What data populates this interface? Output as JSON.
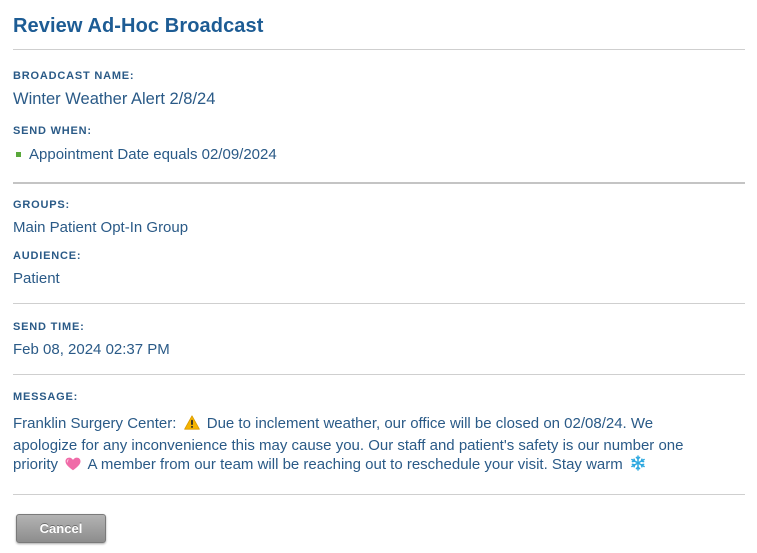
{
  "header": {
    "title": "Review Ad-Hoc Broadcast"
  },
  "broadcast_name": {
    "label": "BROADCAST NAME:",
    "value": "Winter Weather Alert 2/8/24"
  },
  "send_when": {
    "label": "SEND WHEN:",
    "conditions": [
      {
        "text_prefix": "Appointment Date ",
        "operator": "equals",
        "value": " 02/09/2024"
      }
    ]
  },
  "groups": {
    "label": "GROUPS:",
    "value": "Main Patient Opt-In Group"
  },
  "audience": {
    "label": "AUDIENCE:",
    "value": "Patient"
  },
  "send_time": {
    "label": "SEND TIME:",
    "value": "Feb 08, 2024 02:37 PM"
  },
  "message": {
    "label": "MESSAGE:",
    "part1": "Franklin Surgery Center: ",
    "part2": " Due to inclement weather, our office will be closed on 02/08/24. We apologize for any inconvenience this may cause you. Our staff and patient's safety is our number one priority ",
    "part3": " A member from our team will be reaching out to reschedule your visit. Stay warm ",
    "icons": [
      "warning-icon",
      "pink-heart-icon",
      "snowflake-icon"
    ]
  },
  "actions": {
    "cancel_label": "Cancel"
  },
  "colors": {
    "title": "#1d5c94",
    "text": "#2a5a87",
    "bullet": "#59a83a",
    "rule": "#cfcfcf",
    "button": "#9a9a9a"
  }
}
